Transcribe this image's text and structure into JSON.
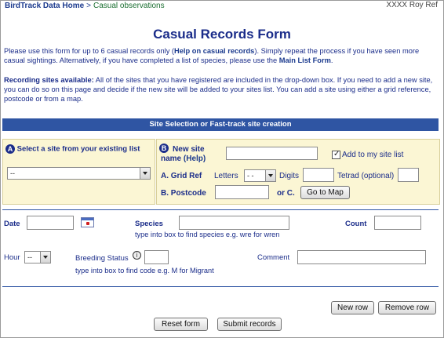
{
  "header": {
    "home_link": "BirdTrack Data Home",
    "separator": ">",
    "section": "Casual observations",
    "user_text": "XXXX Roy Ref"
  },
  "title": "Casual Records Form",
  "intro": {
    "p1_a": "Please use this form for up to 6 casual records only (",
    "p1_help": "Help on casual records",
    "p1_b": "). Simply repeat the process if you have seen more casual sightings. Alternatively, if you have completed a list of species, please use the ",
    "p1_link": "Main List Form",
    "p1_c": ".",
    "p2_bold": "Recording sites available:",
    "p2_text": " All of the sites that you have registered are included in the drop-down box. If you need to add a new site, you can do so on this page and decide if the new site will be added to your sites list. You can add a site using either a grid reference, postcode or from a map."
  },
  "site_bar": "Site Selection or Fast-track site creation",
  "site_panel": {
    "a_badge": "A",
    "a_label": "Select a site from your existing list",
    "a_select_value": "--",
    "b_badge": "B",
    "new_site_label_1": "New site",
    "new_site_label_2": "name",
    "new_site_help": "(Help)",
    "new_site_value": "",
    "add_to_list_label": "Add to my site list",
    "add_to_list_checked": true,
    "grid_ref_label": "A. Grid Ref",
    "letters_label": "Letters",
    "letters_value": "- -",
    "digits_label": "Digits",
    "digits_value": "",
    "tetrad_label": "Tetrad (optional)",
    "tetrad_value": "",
    "postcode_label": "B. Postcode",
    "postcode_value": "",
    "or_c_label": "or C.",
    "map_button": "Go to Map"
  },
  "record": {
    "date_label": "Date",
    "date_value": "",
    "species_label": "Species",
    "species_hint": "type into box to find species e.g. wre for wren",
    "species_value": "",
    "count_label": "Count",
    "count_value": "",
    "hour_label": "Hour",
    "hour_value": "--",
    "breeding_label": "Breeding Status",
    "breeding_value": "",
    "breeding_hint": "type into box to find code e.g. M for Migrant",
    "comment_label": "Comment",
    "comment_value": ""
  },
  "buttons": {
    "new_row": "New row",
    "remove_row": "Remove row",
    "reset": "Reset form",
    "submit": "Submit records"
  },
  "icons": {
    "calendar": "calendar-icon",
    "info": "info-icon",
    "dropdown": "chevron-down-icon",
    "checkbox": "checkmark-icon"
  },
  "colors": {
    "bar_blue": "#2f55a3",
    "panel_yellow": "#fbf6d4",
    "text_navy": "#1b2d8a",
    "crumb_green": "#1a6e30"
  }
}
